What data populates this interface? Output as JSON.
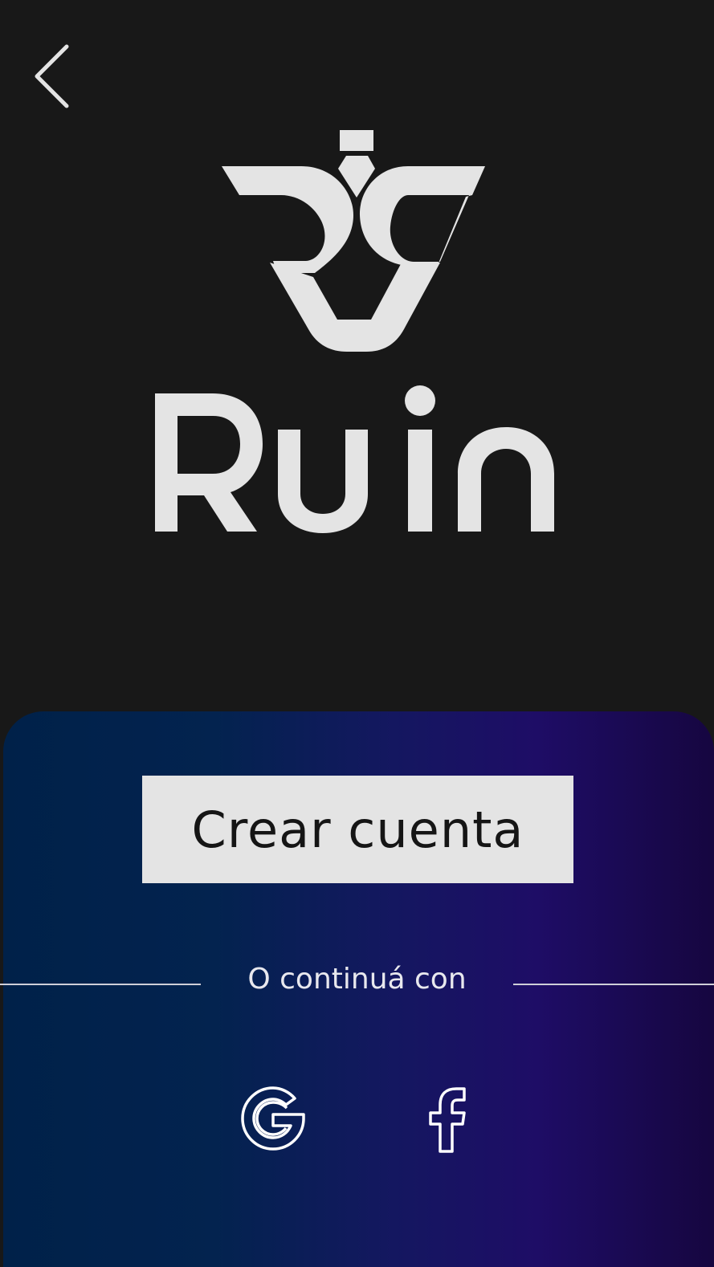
{
  "colors": {
    "background": "#181818",
    "logo": "#e4e4e4",
    "button_bg": "#e4e4e4",
    "button_text": "#151515",
    "panel_gradient": [
      "#002149",
      "#141760",
      "#1e0d66",
      "#160640"
    ]
  },
  "header": {
    "back_icon": "chevron-left-icon"
  },
  "brand": {
    "name": "Ruin",
    "mark_icon": "ruin-logo-mark"
  },
  "actions": {
    "create_account_label": "Crear cuenta"
  },
  "social": {
    "divider_label": "O continuá con",
    "providers": [
      {
        "name": "Google",
        "icon": "google-icon"
      },
      {
        "name": "Facebook",
        "icon": "facebook-icon"
      }
    ]
  }
}
